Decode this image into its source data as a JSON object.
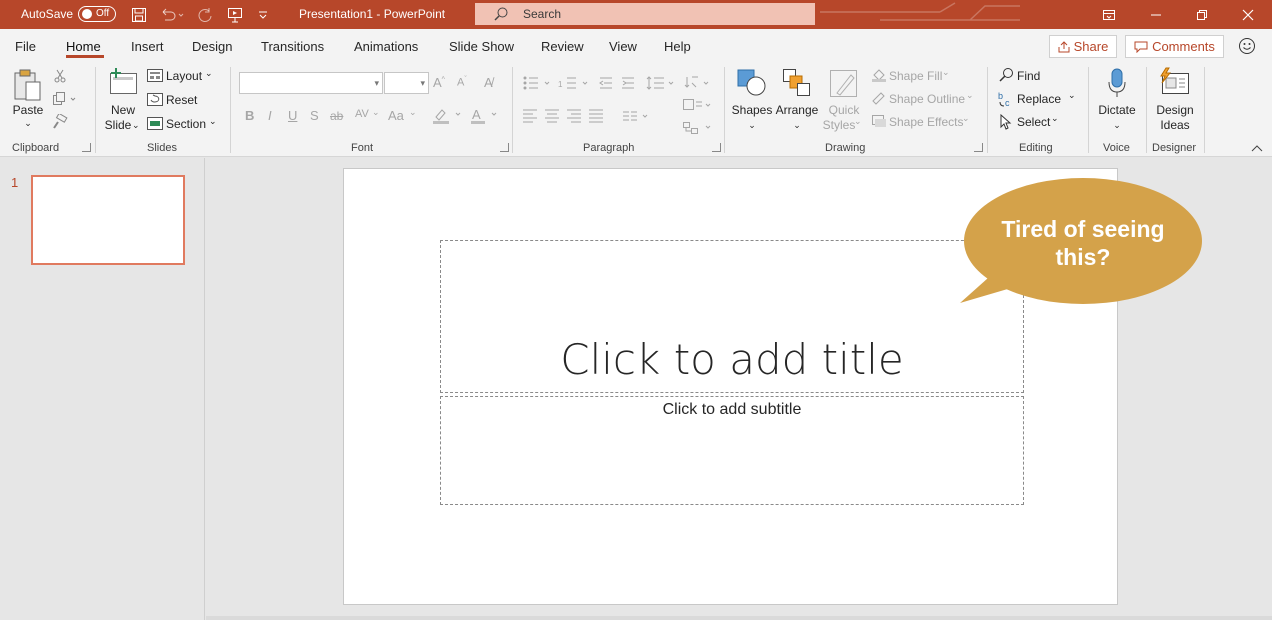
{
  "titlebar": {
    "autosave_label": "AutoSave",
    "autosave_state": "Off",
    "document_title": "Presentation1  -  PowerPoint",
    "search_placeholder": "Search",
    "accent_color": "#b7472a"
  },
  "menu": {
    "tabs": [
      "File",
      "Home",
      "Insert",
      "Design",
      "Transitions",
      "Animations",
      "Slide Show",
      "Review",
      "View",
      "Help"
    ],
    "active_tab": "Home",
    "share_label": "Share",
    "comments_label": "Comments"
  },
  "ribbon": {
    "clipboard": {
      "paste": "Paste",
      "group": "Clipboard"
    },
    "slides": {
      "new_slide_1": "New",
      "new_slide_2": "Slide",
      "layout": "Layout",
      "reset": "Reset",
      "section": "Section",
      "group": "Slides"
    },
    "font": {
      "group": "Font",
      "bold": "B",
      "italic": "I",
      "underline": "U",
      "shadow": "S",
      "strike": "ab",
      "spacing": "AV",
      "case": "Aa"
    },
    "paragraph": {
      "group": "Paragraph"
    },
    "drawing": {
      "shapes": "Shapes",
      "arrange": "Arrange",
      "quick_styles_1": "Quick",
      "quick_styles_2": "Styles",
      "shape_fill": "Shape Fill",
      "shape_outline": "Shape Outline",
      "shape_effects": "Shape Effects",
      "group": "Drawing"
    },
    "editing": {
      "find": "Find",
      "replace": "Replace",
      "select": "Select",
      "group": "Editing"
    },
    "voice": {
      "dictate": "Dictate",
      "group": "Voice"
    },
    "designer": {
      "design_ideas_1": "Design",
      "design_ideas_2": "Ideas",
      "group": "Designer"
    }
  },
  "thumbnails": {
    "slide_number": "1"
  },
  "slide": {
    "title_placeholder": "Click to add title",
    "subtitle_placeholder": "Click to add subtitle"
  },
  "callout": {
    "text_line1": "Tired of seeing",
    "text_line2": "this?",
    "color": "#d4a24a"
  }
}
